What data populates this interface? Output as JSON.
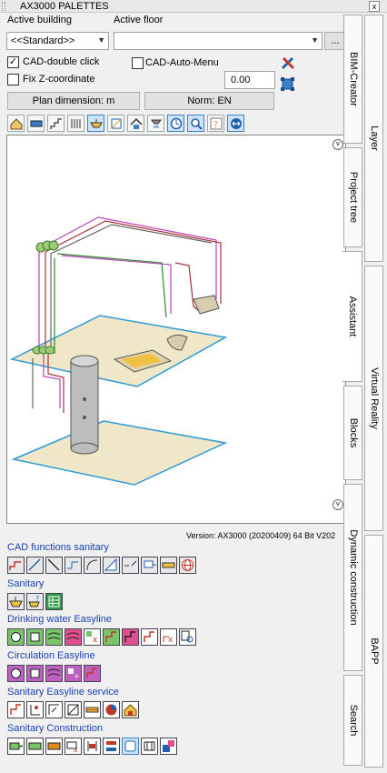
{
  "window": {
    "title": "AX3000 PALETTES",
    "close_label": "x"
  },
  "top": {
    "active_building_label": "Active building",
    "active_floor_label": "Active floor",
    "building_value": "<<Standard>>",
    "floor_value": "",
    "more_label": "..."
  },
  "options": {
    "cad_double_click_label": "CAD-double click",
    "cad_double_click_checked": true,
    "cad_auto_menu_label": "CAD-Auto-Menu",
    "cad_auto_menu_checked": false,
    "fix_z_label": "Fix Z-coordinate",
    "fix_z_checked": false,
    "z_value": "0.00"
  },
  "buttons": {
    "plan_dimension": "Plan dimension: m",
    "norm": "Norm: EN"
  },
  "toolbar_icons": [
    "building-icon",
    "wall-icon",
    "stairs-icon",
    "radiator-icon",
    "washbasin-icon",
    "room-icon",
    "roof-icon",
    "shower-icon",
    "clock-icon",
    "zoom-icon",
    "help-icon",
    "swap-icon"
  ],
  "version": "Version: AX3000 (20200409) 64 Bit V202",
  "sections": [
    {
      "title": "CAD functions sanitary",
      "icons": [
        "stairs-pipe-icon",
        "diagonal-icon",
        "slope-icon",
        "offset-icon",
        "bend-icon",
        "ramp-icon",
        "break-icon",
        "junction-icon",
        "dimension-icon",
        "globe-icon"
      ]
    },
    {
      "title": "Sanitary",
      "icons": [
        "sink-icon",
        "sink-question-icon",
        "table-icon"
      ]
    },
    {
      "title": "Drinking water Easyline",
      "icons": [
        "dw-1-icon",
        "dw-2-icon",
        "dw-3-icon",
        "dw-4-icon",
        "dw-5-icon",
        "dw-6-icon",
        "dw-7-icon",
        "dw-8-icon",
        "dw-9-icon",
        "dw-10-icon"
      ]
    },
    {
      "title": "Circulation Easyline",
      "icons": [
        "circ-1-icon",
        "circ-2-icon",
        "circ-3-icon",
        "circ-4-icon",
        "circ-5-icon"
      ]
    },
    {
      "title": "Sanitary Easyline service",
      "icons": [
        "svc-1-icon",
        "svc-2-icon",
        "svc-3-icon",
        "svc-4-icon",
        "svc-5-icon",
        "svc-6-icon",
        "svc-7-icon"
      ]
    },
    {
      "title": "Sanitary Construction",
      "icons": [
        "con-1-icon",
        "con-2-icon",
        "con-3-icon",
        "con-4-icon",
        "con-5-icon",
        "con-6-icon",
        "con-7-icon",
        "con-8-icon",
        "con-9-icon"
      ]
    }
  ],
  "tabs_inner": [
    "BIM-Creator",
    "Project tree",
    "Assistant",
    "Blocks",
    "Dynamic construction",
    "Search"
  ],
  "tabs_outer": [
    "Layer",
    "Virtual Reality",
    "BAPP"
  ],
  "active_tab": "Assistant"
}
